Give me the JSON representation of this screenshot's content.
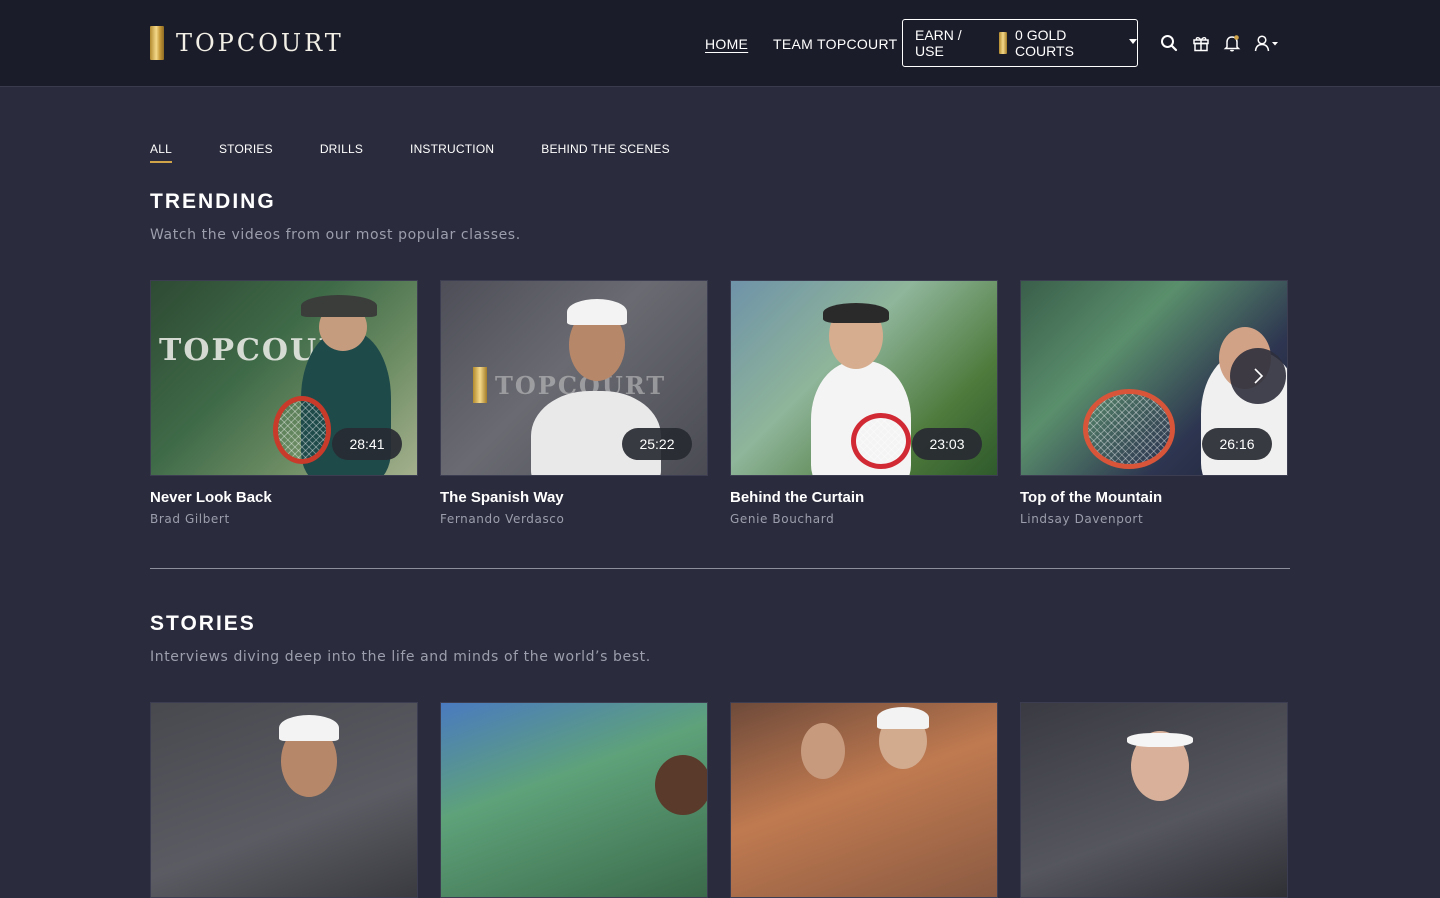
{
  "header": {
    "logo_text": "TOPCOURT",
    "nav": {
      "home": "HOME",
      "team": "TEAM TOPCOURT"
    },
    "earn_button": {
      "label": "EARN / USE",
      "balance": "0 GOLD COURTS"
    },
    "icons": [
      "search-icon",
      "gift-icon",
      "bell-icon",
      "user-icon"
    ]
  },
  "tabs": [
    "ALL",
    "STORIES",
    "DRILLS",
    "INSTRUCTION",
    "BEHIND THE SCENES"
  ],
  "active_tab": "ALL",
  "trending": {
    "title": "TRENDING",
    "subtitle": "Watch the videos from our most popular classes.",
    "cards": [
      {
        "title": "Never Look Back",
        "coach": "Brad Gilbert",
        "duration": "28:41",
        "thumb_text": "TOPCOURT"
      },
      {
        "title": "The Spanish Way",
        "coach": "Fernando Verdasco",
        "duration": "25:22",
        "thumb_text": "TOPCOURT"
      },
      {
        "title": "Behind the Curtain",
        "coach": "Genie Bouchard",
        "duration": "23:03"
      },
      {
        "title": "Top of the Mountain",
        "coach": "Lindsay Davenport",
        "duration": "26:16"
      }
    ]
  },
  "stories": {
    "title": "STORIES",
    "subtitle": "Interviews diving deep into the life and minds of the world’s best."
  },
  "colors": {
    "page_bg": "#2a2b3c",
    "header_bg": "#1b1c29",
    "accent_gold": "#d1a449",
    "muted_text": "#9c9ead"
  }
}
